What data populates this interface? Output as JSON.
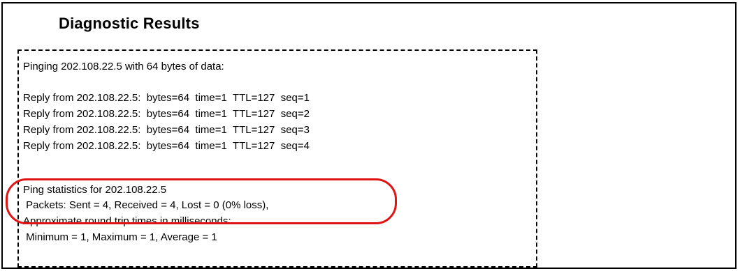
{
  "header": {
    "title": "Diagnostic Results"
  },
  "results": {
    "ping_header": "Pinging 202.108.22.5 with 64 bytes of data:",
    "replies": [
      "Reply from 202.108.22.5:  bytes=64  time=1  TTL=127  seq=1",
      "Reply from 202.108.22.5:  bytes=64  time=1  TTL=127  seq=2",
      "Reply from 202.108.22.5:  bytes=64  time=1  TTL=127  seq=3",
      "Reply from 202.108.22.5:  bytes=64  time=1  TTL=127  seq=4"
    ],
    "stats_title": "Ping statistics for 202.108.22.5",
    "packets": " Packets: Sent = 4, Received = 4, Lost = 0 (0% loss),",
    "approx": "Approximate round trip times in milliseconds:",
    "times": " Minimum = 1, Maximum = 1, Average = 1"
  },
  "colors": {
    "highlight": "#e01414"
  }
}
